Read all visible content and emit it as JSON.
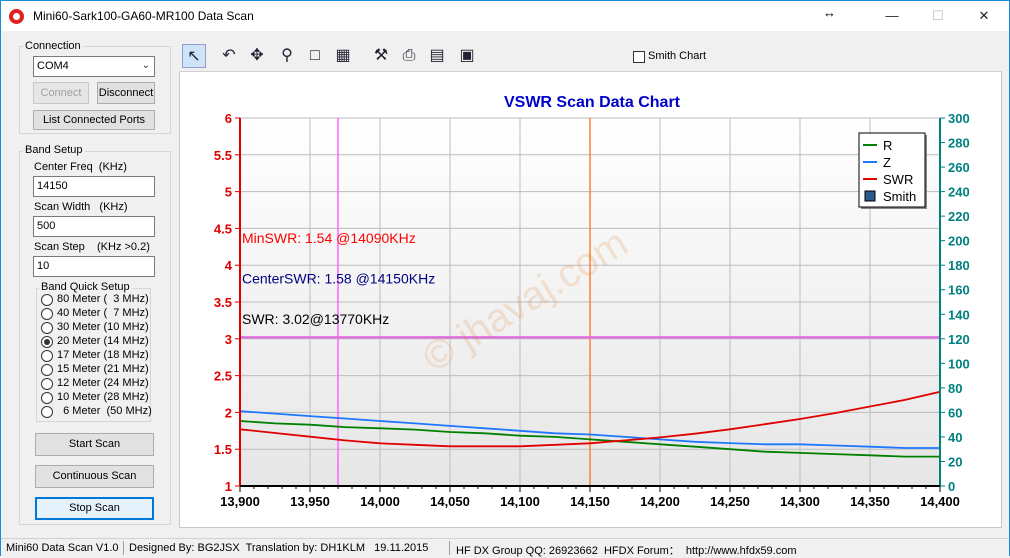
{
  "window": {
    "title": "Mini60-Sark100-GA60-MR100 Data Scan",
    "resize_glyph": "↔",
    "min_glyph": "—",
    "max_glyph": "☐",
    "close_glyph": "✕"
  },
  "connection": {
    "group_title": "Connection",
    "port_value": "COM4",
    "connect_label": "Connect",
    "disconnect_label": "Disconnect",
    "list_ports_label": "List Connected Ports"
  },
  "band_setup": {
    "group_title": "Band Setup",
    "center_freq_label": "Center Freq  (KHz)",
    "center_freq_value": "14150",
    "scan_width_label": "Scan Width   (KHz)",
    "scan_width_value": "500",
    "scan_step_label": "Scan Step",
    "scan_step_hint": "(KHz >0.2)",
    "scan_step_value": "10"
  },
  "band_quick": {
    "group_title": "Band Quick Setup",
    "options": [
      {
        "label": "80 Meter (  3 MHz)",
        "checked": false
      },
      {
        "label": "40 Meter (  7 MHz)",
        "checked": false
      },
      {
        "label": "30 Meter (10 MHz)",
        "checked": false
      },
      {
        "label": "20 Meter (14 MHz)",
        "checked": true
      },
      {
        "label": "17 Meter (18 MHz)",
        "checked": false
      },
      {
        "label": "15 Meter (21 MHz)",
        "checked": false
      },
      {
        "label": "12 Meter (24 MHz)",
        "checked": false
      },
      {
        "label": "10 Meter (28 MHz)",
        "checked": false
      },
      {
        "label": "  6 Meter  (50 MHz)",
        "checked": false
      }
    ]
  },
  "scan_buttons": {
    "start": "Start Scan",
    "continuous": "Continuous Scan",
    "stop": "Stop Scan"
  },
  "toolbar": {
    "icons": [
      "pointer-icon",
      "undo-icon",
      "pan-icon",
      "zoom-icon",
      "export-image-icon",
      "properties-icon",
      "settings-icon",
      "print-icon",
      "data-table-icon",
      "save-icon"
    ],
    "smith_chart_label": "Smith Chart"
  },
  "chart_data": {
    "type": "line",
    "title": "VSWR Scan Data Chart",
    "xlabel": "",
    "ylabel": "",
    "x_ticks": [
      "13,900",
      "13,950",
      "14,000",
      "14,050",
      "14,100",
      "14,150",
      "14,200",
      "14,250",
      "14,300",
      "14,350",
      "14,400"
    ],
    "xlim": [
      13900,
      14400
    ],
    "left_ticks": [
      "1",
      "1.5",
      "2",
      "2.5",
      "3",
      "3.5",
      "4",
      "4.5",
      "5",
      "5.5",
      "6"
    ],
    "left_ylim": [
      1,
      6
    ],
    "right_ticks": [
      "0",
      "20",
      "40",
      "60",
      "80",
      "100",
      "120",
      "140",
      "160",
      "180",
      "200",
      "220",
      "240",
      "260",
      "280",
      "300"
    ],
    "right_ylim": [
      0,
      300
    ],
    "grid": true,
    "legend_placement": "top-right",
    "legend": [
      {
        "name": "R",
        "color": "#008000"
      },
      {
        "name": "Z",
        "color": "#1e78ff"
      },
      {
        "name": "SWR",
        "color": "#e00000"
      },
      {
        "name": "Smith",
        "color": "#2c5a8c"
      }
    ],
    "series": [
      {
        "name": "R",
        "axis": "right",
        "color": "#008000",
        "x": [
          13900,
          13925,
          13950,
          13975,
          14000,
          14025,
          14050,
          14075,
          14100,
          14125,
          14150,
          14175,
          14200,
          14225,
          14250,
          14275,
          14300,
          14325,
          14350,
          14375,
          14400
        ],
        "values": [
          53,
          51,
          50,
          48,
          47,
          46,
          44,
          43,
          41,
          40,
          38,
          36,
          34,
          32,
          30,
          28,
          27,
          26,
          25,
          24,
          24
        ]
      },
      {
        "name": "Z",
        "axis": "right",
        "color": "#1e78ff",
        "x": [
          13900,
          13925,
          13950,
          13975,
          14000,
          14025,
          14050,
          14075,
          14100,
          14125,
          14150,
          14175,
          14200,
          14225,
          14250,
          14275,
          14300,
          14325,
          14350,
          14375,
          14400
        ],
        "values": [
          61,
          59,
          57,
          55,
          53,
          51,
          49,
          47,
          45,
          43,
          42,
          40,
          38,
          36,
          35,
          34,
          34,
          33,
          32,
          31,
          31
        ]
      },
      {
        "name": "SWR",
        "axis": "left",
        "color": "#e00000",
        "x": [
          13900,
          13925,
          13950,
          13975,
          14000,
          14025,
          14050,
          14075,
          14100,
          14125,
          14150,
          14175,
          14200,
          14225,
          14250,
          14275,
          14300,
          14325,
          14350,
          14375,
          14400
        ],
        "values": [
          1.77,
          1.72,
          1.67,
          1.62,
          1.58,
          1.56,
          1.54,
          1.54,
          1.54,
          1.56,
          1.58,
          1.62,
          1.66,
          1.71,
          1.77,
          1.84,
          1.91,
          1.99,
          2.08,
          2.17,
          2.28
        ]
      }
    ],
    "vertical_markers": [
      {
        "x": 13970,
        "color": "#ff66ff"
      },
      {
        "x": 14150,
        "color": "#ff8030"
      }
    ],
    "horizontal_markers": [
      {
        "y": 3.02,
        "axis": "left",
        "color": "#e070e0"
      }
    ],
    "annotations": [
      {
        "text": "MinSWR: 1.54 @14090KHz",
        "color": "#ff0000",
        "y": 4.3
      },
      {
        "text": "CenterSWR: 1.58 @14150KHz",
        "color": "#000080",
        "y": 3.75
      },
      {
        "text": "SWR: 3.02@13770KHz",
        "color": "#000000",
        "y": 3.2
      }
    ],
    "watermark": "© jhavaj.com"
  },
  "status": {
    "version": "Mini60 Data Scan V1.0",
    "designed": "Designed By: BG2JSX  Translation by: DH1KLM   19.11.2015",
    "group": "HF DX Group QQ: 26923662  HFDX Forum：  http://www.hfdx59.com"
  }
}
